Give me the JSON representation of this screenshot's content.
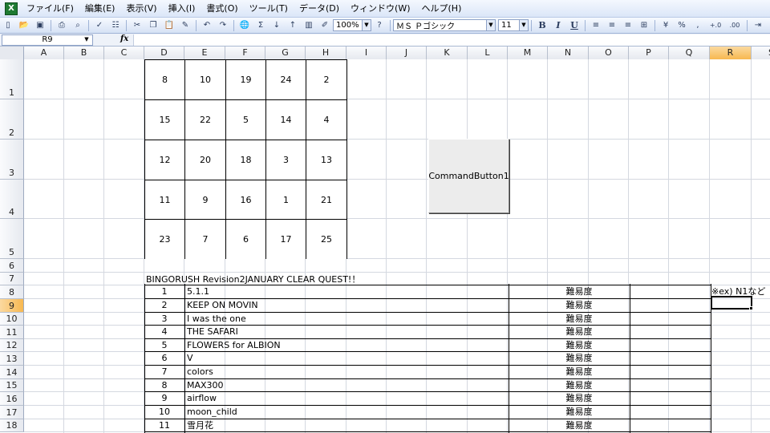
{
  "app": {
    "menus": [
      "ファイル(F)",
      "編集(E)",
      "表示(V)",
      "挿入(I)",
      "書式(O)",
      "ツール(T)",
      "データ(D)",
      "ウィンドウ(W)",
      "ヘルプ(H)"
    ]
  },
  "toolbar": {
    "zoom": "100%",
    "font_name": "ＭＳ Ｐゴシック",
    "font_size": "11",
    "bold": "B",
    "italic": "I",
    "underline": "U",
    "percent": "%",
    "comma": ",",
    "increase_decimal": "+.0",
    "decrease_decimal": ".00",
    "sum": "Σ",
    "fx": "fx"
  },
  "formula_bar": {
    "name_box": "R9",
    "formula": ""
  },
  "grid": {
    "columns": [
      "A",
      "B",
      "C",
      "D",
      "E",
      "F",
      "G",
      "H",
      "I",
      "J",
      "K",
      "L",
      "M",
      "N",
      "O",
      "P",
      "Q",
      "R",
      "S"
    ],
    "rows": [
      "1",
      "2",
      "3",
      "4",
      "5",
      "6",
      "7",
      "8",
      "9",
      "10",
      "11",
      "12",
      "13",
      "14",
      "15",
      "16",
      "17",
      "18"
    ],
    "selected_column": "R",
    "selected_row": "9"
  },
  "bingo": [
    [
      "8",
      "10",
      "19",
      "24",
      "2"
    ],
    [
      "15",
      "22",
      "5",
      "14",
      "4"
    ],
    [
      "12",
      "20",
      "18",
      "3",
      "13"
    ],
    [
      "11",
      "9",
      "16",
      "1",
      "21"
    ],
    [
      "23",
      "7",
      "6",
      "17",
      "25"
    ]
  ],
  "command_button": {
    "label": "CommandButton1"
  },
  "quest": {
    "title": "BINGORUSH Revision2JANUARY CLEAR QUEST!！",
    "difficulty_label": "難易度",
    "rows": [
      {
        "num": "1",
        "song": "5.1.1",
        "difficulty": "難易度"
      },
      {
        "num": "2",
        "song": "KEEP ON MOVIN",
        "difficulty": "難易度"
      },
      {
        "num": "3",
        "song": "I was the one",
        "difficulty": "難易度"
      },
      {
        "num": "4",
        "song": "THE SAFARI",
        "difficulty": "難易度"
      },
      {
        "num": "5",
        "song": "FLOWERS for ALBION",
        "difficulty": "難易度"
      },
      {
        "num": "6",
        "song": "V",
        "difficulty": "難易度"
      },
      {
        "num": "7",
        "song": "colors",
        "difficulty": "難易度"
      },
      {
        "num": "8",
        "song": "MAX300",
        "difficulty": "難易度"
      },
      {
        "num": "9",
        "song": "airflow",
        "difficulty": "難易度"
      },
      {
        "num": "10",
        "song": "moon_child",
        "difficulty": "難易度"
      },
      {
        "num": "11",
        "song": "雪月花",
        "difficulty": "難易度"
      }
    ]
  },
  "note": "※ex) N1など",
  "colors": {
    "selection_header": "#f7b850",
    "gridline": "#d4d8e0",
    "toolbar_bg": "#d6e2f5"
  }
}
